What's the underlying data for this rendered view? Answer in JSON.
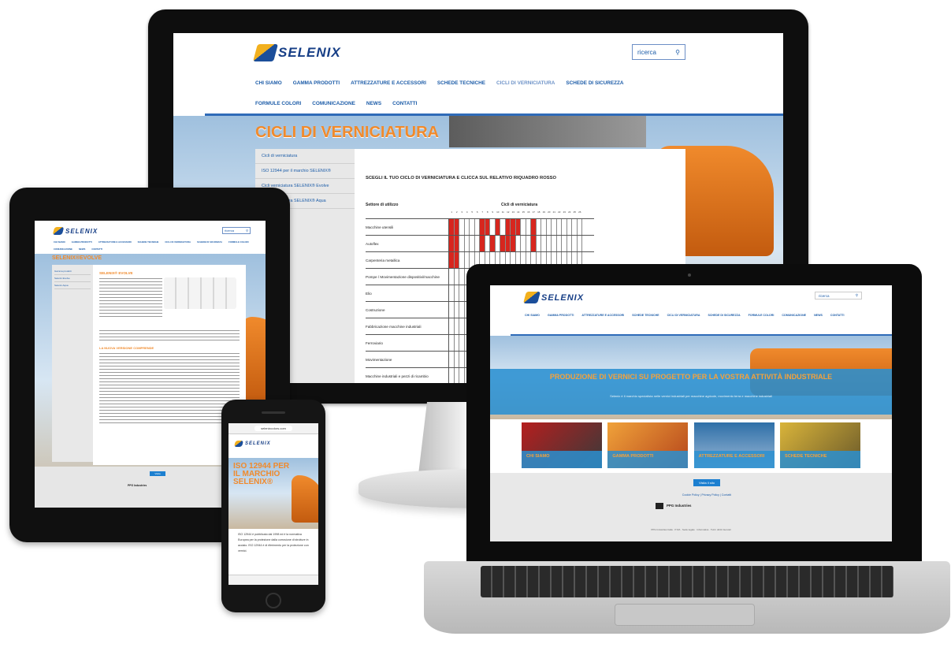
{
  "brand": {
    "name": "SELENIX"
  },
  "monitor": {
    "search": {
      "label": "ricerca",
      "icon": "search-icon"
    },
    "nav": [
      "CHI SIAMO",
      "GAMMA PRODOTTI",
      "ATTREZZATURE E ACCESSORI",
      "SCHEDE TECNICHE",
      "CICLI DI VERNICIATURA",
      "SCHEDE DI SICUREZZA",
      "FORMULE COLORI",
      "COMUNICAZIONE",
      "NEWS",
      "CONTATTI"
    ],
    "hero_title": "CICLI DI VERNICIATURA",
    "sidebar": [
      "Cicli di verniciatura",
      "ISO 12944 per il marchio SELENIX®",
      "Cicli verniciatura SELENIX® Evolve",
      "Cicli verniciatura SELENIX® Aqua"
    ],
    "instruction": "SCEGLI IL TUO CICLO DI VERNICIATURA E CLICCA SUL RELATIVO RIQUADRO ROSSO",
    "table": {
      "col_sector": "Settore di utilizzo",
      "col_cycles": "Cicli di verniciatura",
      "cycle_numbers": [
        "1",
        "2",
        "3",
        "4",
        "5",
        "6",
        "7",
        "8",
        "9",
        "10",
        "11",
        "12",
        "13",
        "14",
        "15",
        "16",
        "17",
        "18",
        "19",
        "20",
        "21",
        "22",
        "23",
        "24",
        "25",
        "26"
      ],
      "rows": [
        {
          "label": "Macchine utensili",
          "marks": [
            1,
            1,
            0,
            0,
            0,
            0,
            1,
            1,
            0,
            1,
            0,
            1,
            1,
            1,
            0,
            0,
            1,
            0,
            0,
            0,
            0,
            0,
            0,
            0,
            0,
            0
          ]
        },
        {
          "label": "Autoflex",
          "marks": [
            1,
            1,
            0,
            0,
            0,
            0,
            1,
            0,
            1,
            0,
            1,
            1,
            1,
            0,
            0,
            0,
            1,
            0,
            0,
            0,
            0,
            0,
            0,
            0,
            0,
            0
          ]
        },
        {
          "label": "Carpenteria metallica",
          "marks": [
            1,
            1,
            0,
            0,
            0,
            0,
            0,
            0,
            0,
            0,
            0,
            0,
            0,
            0,
            0,
            0,
            0,
            0,
            0,
            0,
            0,
            0,
            0,
            0,
            0,
            0
          ]
        },
        {
          "label": "Pompe / Movimentazione dispositivi/macchine",
          "marks": [
            0,
            0,
            0,
            0,
            0,
            0,
            0,
            0,
            0,
            0,
            0,
            0,
            0,
            0,
            0,
            0,
            0,
            0,
            0,
            0,
            0,
            0,
            0,
            0,
            0,
            0
          ]
        },
        {
          "label": "Elio",
          "marks": [
            0,
            0,
            0,
            0,
            0,
            0,
            0,
            0,
            0,
            0,
            0,
            0,
            0,
            0,
            0,
            0,
            0,
            0,
            0,
            0,
            0,
            0,
            0,
            0,
            0,
            0
          ]
        },
        {
          "label": "Costruzione",
          "marks": [
            0,
            0,
            0,
            0,
            0,
            0,
            0,
            0,
            0,
            0,
            0,
            0,
            0,
            0,
            0,
            0,
            0,
            0,
            0,
            0,
            0,
            0,
            0,
            0,
            0,
            0
          ]
        },
        {
          "label": "Fabbricazione macchine industriali",
          "marks": [
            0,
            0,
            0,
            0,
            0,
            0,
            0,
            0,
            0,
            0,
            0,
            0,
            0,
            0,
            0,
            0,
            0,
            0,
            0,
            0,
            0,
            0,
            0,
            0,
            0,
            0
          ]
        },
        {
          "label": "Ferroviario",
          "marks": [
            0,
            0,
            0,
            0,
            0,
            0,
            0,
            0,
            0,
            0,
            0,
            0,
            0,
            0,
            0,
            0,
            0,
            0,
            0,
            0,
            0,
            0,
            0,
            0,
            0,
            0
          ]
        },
        {
          "label": "Movimentazione",
          "marks": [
            0,
            0,
            0,
            0,
            0,
            0,
            0,
            0,
            0,
            0,
            0,
            0,
            0,
            0,
            0,
            0,
            0,
            0,
            0,
            0,
            0,
            0,
            0,
            0,
            0,
            0
          ]
        },
        {
          "label": "Macchine industriali e pezzi di ricambio",
          "marks": [
            0,
            0,
            0,
            0,
            0,
            0,
            0,
            0,
            0,
            0,
            0,
            0,
            0,
            0,
            0,
            0,
            0,
            0,
            0,
            0,
            0,
            0,
            0,
            0,
            0,
            0
          ]
        }
      ]
    }
  },
  "laptop": {
    "search": {
      "label": "ricerca"
    },
    "nav": [
      "CHI SIAMO",
      "GAMMA PRODOTTI",
      "ATTREZZATURE E ACCESSORI",
      "SCHEDE TECNICHE",
      "CICLI DI VERNICIATURA",
      "SCHEDE DI SICUREZZA",
      "FORMULE COLORI",
      "COMUNICAZIONE",
      "NEWS",
      "CONTATTI"
    ],
    "hero_title": "PRODUZIONE DI VERNICI SU PROGETTO PER LA VOSTRA ATTIVITÀ INDUSTRIALE",
    "hero_sub": "Selenix è il marchio specialista nelle vernici industriali per macchine agricole, movimento terra e macchine industriali",
    "tiles": [
      "CHI SIAMO",
      "GAMMA PRODOTTI",
      "ATTREZZATURE E ACCESSORI",
      "SCHEDE TECNICHE"
    ],
    "button": "Visita il sito",
    "footer_links": "Cookie Policy | Privacy Policy | Contatti",
    "footer_brand": "PPG Industries",
    "footer_small": "PPG Industries Italia · P.IVA · Sede legale · Informativa · Tutti i diritti riservati"
  },
  "tablet": {
    "search": {
      "label": "ricerca"
    },
    "nav": [
      "CHI SIAMO",
      "GAMMA PRODOTTI",
      "ATTREZZATURE E ACCESSORI",
      "SCHEDE TECNICHE",
      "CICLI DI VERNICIATURA",
      "SCHEDE DI SICUREZZA",
      "FORMULE COLORI",
      "COMUNICAZIONE",
      "NEWS",
      "CONTATTI"
    ],
    "hero_title": "SELENIX®EVOLVE",
    "sidebar": [
      "Gamma prodotti",
      "Selenix Evolve",
      "Selenix Aqua"
    ],
    "heading": "SELENIX® EVOLVE",
    "heading2": "LA NUOVA VERSIONE COMPRENDE",
    "button": "Visita",
    "footer_brand": "PPG Industries"
  },
  "phone": {
    "url": "selenixcolors.com",
    "hero_title": "ISO 12944 PER IL MARCHIO SELENIX®",
    "body": "ISO 12944 è pubblicato dal 1998 ed è la normativa Europea per la protezione dalla corrosione di strutture in acciaio. ISO 12944 è di riferimento per la protezione con vernici."
  },
  "colors": {
    "brand_blue": "#1c5ca8",
    "accent_orange": "#f08a2c",
    "cell_red": "#d7261e",
    "hero_bar": "#2a8fd0"
  }
}
